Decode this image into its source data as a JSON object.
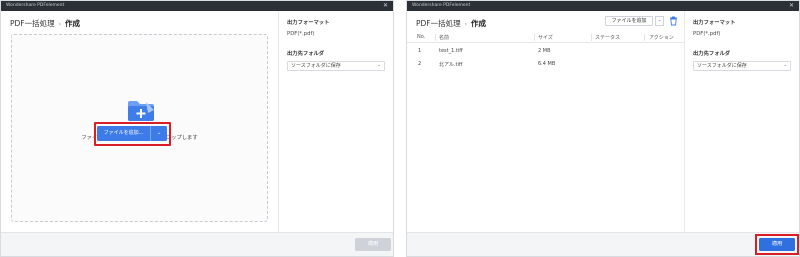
{
  "left_window": {
    "title": "Wondershare PDFelement",
    "breadcrumb": {
      "parent": "PDF一括処理",
      "separator": "›",
      "current": "作成"
    },
    "dropzone": {
      "text": "ファイルをここにドラッグアンドドロップします",
      "add_button": "ファイルを追加...",
      "dropdown": "⌄"
    },
    "side": {
      "output_format_label": "出力フォーマット",
      "output_format_value": "PDF(*.pdf)",
      "output_folder_label": "出力先フォルダ",
      "output_folder_value": "ソースフォルダに保存"
    },
    "apply_label": "適用"
  },
  "right_window": {
    "title": "Wondershare PDFelement",
    "breadcrumb": {
      "parent": "PDF一括処理",
      "separator": "›",
      "current": "作成"
    },
    "toolbar": {
      "add_files": "ファイルを追加",
      "dropdown": "⌄"
    },
    "table": {
      "columns": [
        "No.",
        "名前",
        "サイズ",
        "ステータス",
        "アクション"
      ],
      "rows": [
        {
          "no": "1",
          "name": "test_1.tiff",
          "size": "2 MB"
        },
        {
          "no": "2",
          "name": "北アル.tiff",
          "size": "6.4 MB"
        }
      ]
    },
    "side": {
      "output_format_label": "出力フォーマット",
      "output_format_value": "PDF(*.pdf)",
      "output_folder_label": "出力先フォルダ",
      "output_folder_value": "ソースフォルダに保存"
    },
    "apply_label": "適用"
  },
  "colors": {
    "accent": "#3d7ce8",
    "highlight": "#d81f26",
    "titlebar": "#2b2f36"
  }
}
